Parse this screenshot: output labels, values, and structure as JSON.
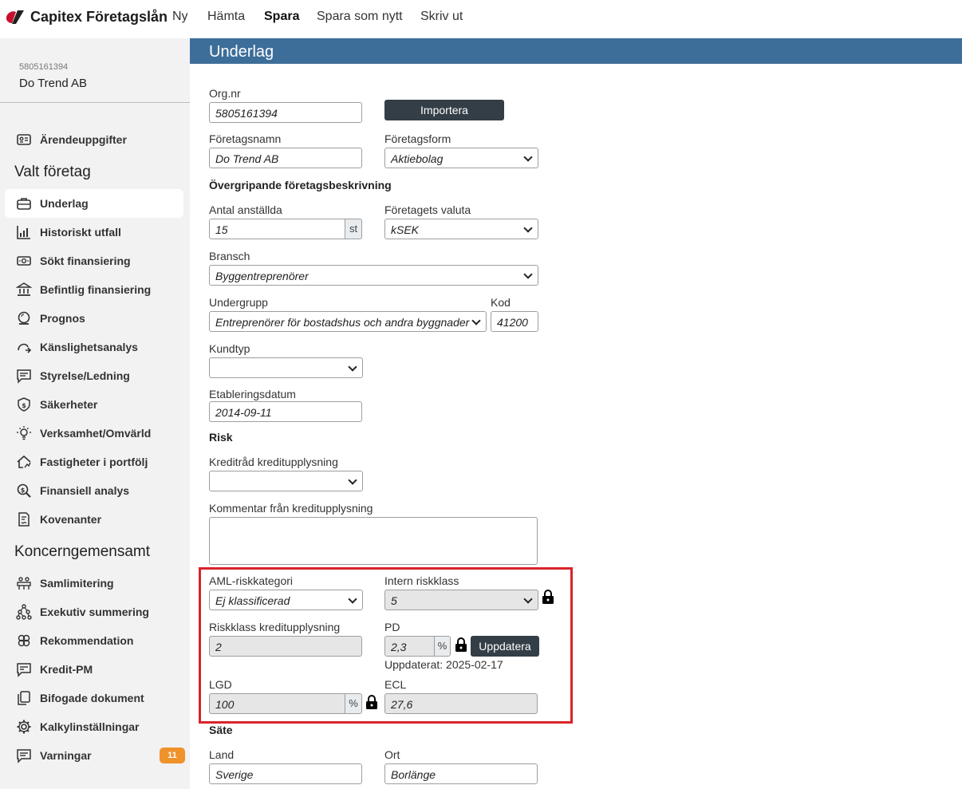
{
  "app": {
    "brand": "Capitex Företagslån"
  },
  "topnav": [
    "Ny",
    "Hämta",
    "Spara",
    "Spara som nytt",
    "Skriv ut"
  ],
  "company": {
    "orgnr": "5805161394",
    "name": "Do Trend AB"
  },
  "sidebar": {
    "top_item": "Ärendeuppgifter",
    "section_valt": "Valt företag",
    "valt_items": [
      "Underlag",
      "Historiskt utfall",
      "Sökt finansiering",
      "Befintlig finansiering",
      "Prognos",
      "Känslighetsanalys",
      "Styrelse/Ledning",
      "Säkerheter",
      "Verksamhet/Omvärld",
      "Fastigheter i portfölj",
      "Finansiell analys",
      "Kovenanter"
    ],
    "section_koncern": "Koncerngemensamt",
    "koncern_items": [
      "Samlimitering",
      "Exekutiv summering",
      "Rekommendation",
      "Kredit-PM",
      "Bifogade dokument",
      "Kalkylinställningar",
      "Varningar"
    ],
    "varningar_badge": "11"
  },
  "main": {
    "title": "Underlag",
    "orgnr_label": "Org.nr",
    "orgnr_value": "5805161394",
    "import_button": "Importera",
    "foretagsnamn_label": "Företagsnamn",
    "foretagsnamn_value": "Do Trend AB",
    "foretagsform_label": "Företagsform",
    "foretagsform_value": "Aktiebolag",
    "section_beskrivning": "Övergripande företagsbeskrivning",
    "antal_label": "Antal anställda",
    "antal_value": "15",
    "antal_unit": "st",
    "valuta_label": "Företagets valuta",
    "valuta_value": "kSEK",
    "bransch_label": "Bransch",
    "bransch_value": "Byggentreprenörer",
    "undergrupp_label": "Undergrupp",
    "undergrupp_value": "Entreprenörer för bostadshus och andra byggnader",
    "kod_label": "Kod",
    "kod_value": "41200",
    "kundtyp_label": "Kundtyp",
    "kundtyp_value": "",
    "etablering_label": "Etableringsdatum",
    "etablering_value": "2014-09-11",
    "section_risk": "Risk",
    "kreditrad_label": "Kreditråd kreditupplysning",
    "kreditrad_value": "",
    "kommentar_label": "Kommentar från kreditupplysning",
    "aml_label": "AML-riskkategori",
    "aml_value": "Ej klassificerad",
    "intern_label": "Intern riskklass",
    "intern_value": "5",
    "riskklass_label": "Riskklass kreditupplysning",
    "riskklass_value": "2",
    "pd_label": "PD",
    "pd_value": "2,3",
    "pd_unit": "%",
    "update_button": "Uppdatera",
    "updated_text": "Uppdaterat: 2025-02-17",
    "lgd_label": "LGD",
    "lgd_value": "100",
    "lgd_unit": "%",
    "ecl_label": "ECL",
    "ecl_value": "27,6",
    "section_sate": "Säte",
    "land_label": "Land",
    "land_value": "Sverige",
    "ort_label": "Ort",
    "ort_value": "Borlänge"
  },
  "colors": {
    "header": "#3d6e9a",
    "highlight": "#d9242a",
    "badge": "#f0922b",
    "sidebar": "#f2f2f2"
  }
}
